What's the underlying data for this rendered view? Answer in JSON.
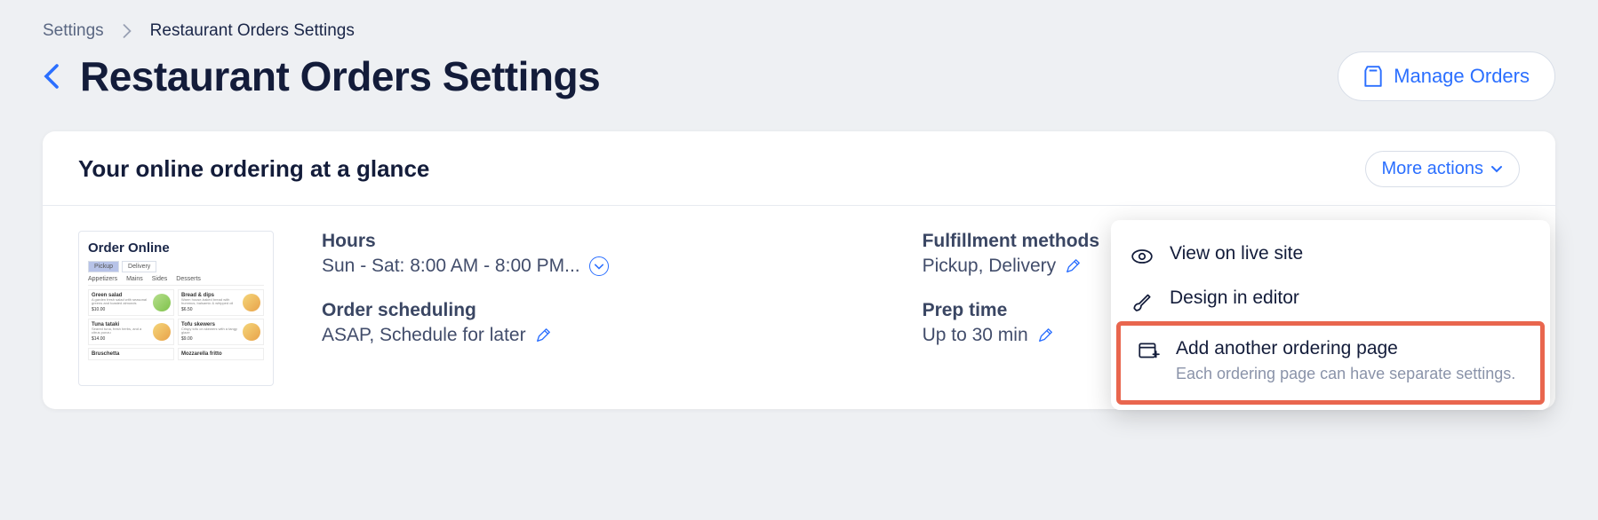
{
  "breadcrumb": {
    "parent": "Settings",
    "current": "Restaurant Orders Settings"
  },
  "page": {
    "title": "Restaurant Orders Settings"
  },
  "header_actions": {
    "manage_label": "Manage Orders"
  },
  "card": {
    "title": "Your online ordering at a glance",
    "more_actions_label": "More actions",
    "preview": {
      "title": "Order Online",
      "tabs": [
        "Pickup",
        "Delivery"
      ],
      "categories": [
        "Appetizers",
        "Mains",
        "Sides",
        "Desserts"
      ],
      "items": [
        {
          "name": "Green salad",
          "price": "$10.00"
        },
        {
          "name": "Bread & dips",
          "price": "$6.50"
        },
        {
          "name": "Tuna tataki",
          "price": "$14.00"
        },
        {
          "name": "Tofu skewers",
          "price": "$9.00"
        },
        {
          "name": "Bruschetta",
          "price": ""
        },
        {
          "name": "Mozzarella fritto",
          "price": ""
        }
      ]
    },
    "sections": {
      "hours": {
        "label": "Hours",
        "value": "Sun - Sat: 8:00 AM - 8:00 PM..."
      },
      "scheduling": {
        "label": "Order scheduling",
        "value": "ASAP, Schedule for later"
      },
      "fulfillment": {
        "label": "Fulfillment methods",
        "value": "Pickup, Delivery"
      },
      "prep": {
        "label": "Prep time",
        "value": "Up to 30 min"
      }
    }
  },
  "dropdown": {
    "items": [
      {
        "title": "View on live site"
      },
      {
        "title": "Design in editor"
      },
      {
        "title": "Add another ordering page",
        "subtitle": "Each ordering page can have separate settings."
      }
    ]
  }
}
